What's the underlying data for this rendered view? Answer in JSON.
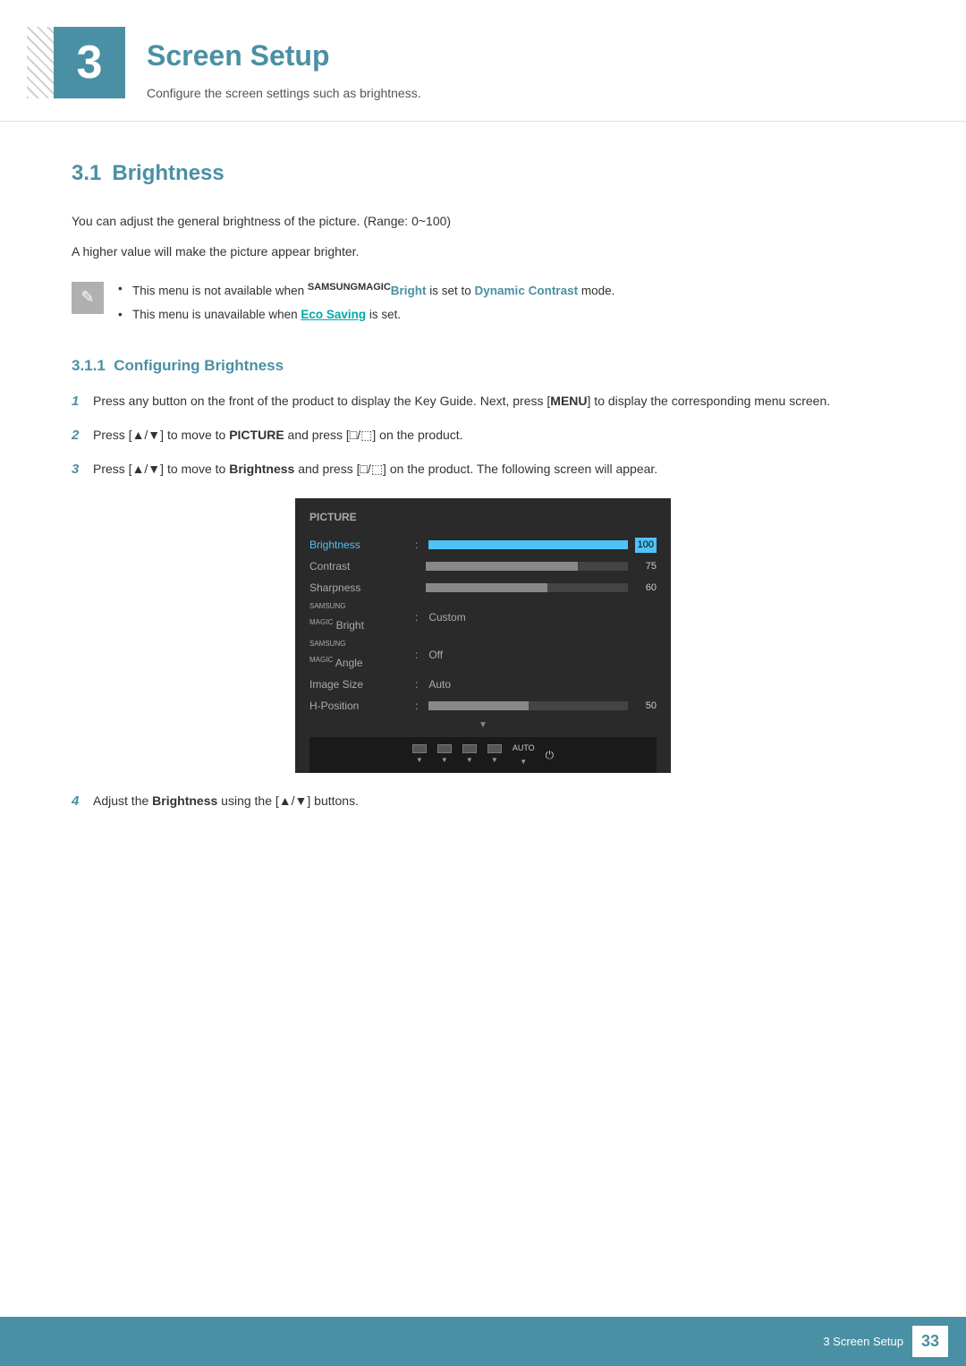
{
  "header": {
    "chapter_number": "3",
    "title": "Screen Setup",
    "subtitle": "Configure the screen settings such as brightness."
  },
  "section_3_1": {
    "number": "3.1",
    "title": "Brightness",
    "desc1": "You can adjust the general brightness of the picture. (Range: 0~100)",
    "desc2": "A higher value will make the picture appear brighter.",
    "note1_prefix": "This menu is not available when ",
    "note1_brand": "SAMSUNG",
    "note1_brand2": "MAGIC",
    "note1_bold": "Bright",
    "note1_suffix": " is set to ",
    "note1_link": "Dynamic Contrast",
    "note1_end": " mode.",
    "note2_prefix": "This menu is unavailable when ",
    "note2_link": "Eco Saving",
    "note2_suffix": " is set."
  },
  "section_3_1_1": {
    "number": "3.1.1",
    "title": "Configuring Brightness",
    "step1": "Press any button on the front of the product to display the Key Guide. Next, press [MENU] to display the corresponding menu screen.",
    "step1_bold": "MENU",
    "step2_prefix": "Press [▲/▼] to move to ",
    "step2_bold": "PICTURE",
    "step2_suffix": " and press [□/⬚] on the product.",
    "step3_prefix": "Press [▲/▼] to move to ",
    "step3_bold": "Brightness",
    "step3_suffix": " and press [□/⬚] on the product. The following screen will appear.",
    "step4_prefix": "Adjust the ",
    "step4_bold": "Brightness",
    "step4_suffix": " using the [▲/▼] buttons."
  },
  "osd": {
    "title": "PICTURE",
    "rows": [
      {
        "label": "Brightness",
        "type": "bar",
        "fill": 100,
        "value": "100",
        "selected": true
      },
      {
        "label": "Contrast",
        "type": "bar",
        "fill": 75,
        "value": "75",
        "selected": false
      },
      {
        "label": "Sharpness",
        "type": "bar",
        "fill": 60,
        "value": "60",
        "selected": false
      },
      {
        "label": "SAMSUNGMAGICBright",
        "type": "text",
        "value": "Custom",
        "selected": false
      },
      {
        "label": "SAMSUNGMAGICAngle",
        "type": "text",
        "value": "Off",
        "selected": false
      },
      {
        "label": "Image Size",
        "type": "text",
        "value": "Auto",
        "selected": false
      },
      {
        "label": "H-Position",
        "type": "bar",
        "fill": 50,
        "value": "50",
        "selected": false
      }
    ],
    "buttons": [
      "◄",
      "■",
      "＋",
      "⬚",
      "AUTO",
      "⏻"
    ]
  },
  "footer": {
    "text": "3 Screen Setup",
    "page": "33"
  }
}
